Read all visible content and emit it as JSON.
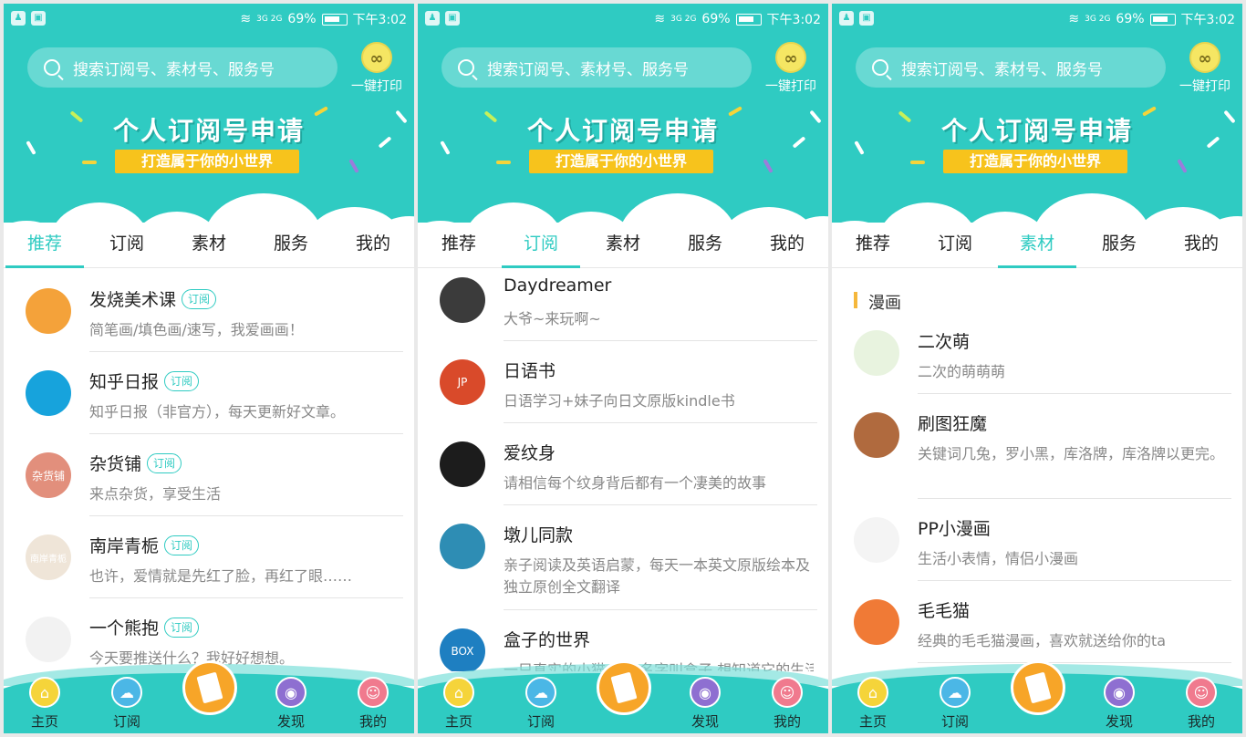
{
  "status_bar": {
    "battery": "69%",
    "time": "下午3:02",
    "network": "3G 2G"
  },
  "header": {
    "search_placeholder": "搜索订阅号、素材号、服务号",
    "print_label": "一键打印",
    "banner_title": "个人订阅号申请",
    "banner_subtitle": "打造属于你的小世界"
  },
  "tabs": [
    "推荐",
    "订阅",
    "素材",
    "服务",
    "我的"
  ],
  "bottom_nav": [
    "主页",
    "订阅",
    "发现",
    "我的"
  ],
  "screens": [
    {
      "active_tab": 0,
      "items": [
        {
          "title": "发烧美术课",
          "badge": "订阅",
          "desc": "简笔画/填色画/速写，我爱画画！",
          "avatar_color": "#f4a23a",
          "avatar_text": ""
        },
        {
          "title": "知乎日报",
          "badge": "订阅",
          "desc": "知乎日报（非官方），每天更新好文章。",
          "avatar_color": "#17a3dc",
          "avatar_text": ""
        },
        {
          "title": "杂货铺",
          "badge": "订阅",
          "desc": "来点杂货，享受生活",
          "avatar_color": "#e28f7c",
          "avatar_text": "杂货铺"
        },
        {
          "title": "南岸青栀",
          "badge": "订阅",
          "desc": "也许，爱情就是先红了脸，再红了眼……",
          "avatar_color": "#efe5d8",
          "avatar_text": "南岸青栀"
        },
        {
          "title": "一个熊抱",
          "badge": "订阅",
          "desc": "今天要推送什么？我好好想想。",
          "avatar_color": "#f2f2f2",
          "avatar_text": ""
        }
      ]
    },
    {
      "active_tab": 1,
      "items": [
        {
          "title": "Daydreamer",
          "desc": "大爷~来玩啊~",
          "avatar_color": "#3b3b3b",
          "avatar_text": ""
        },
        {
          "title": "日语书",
          "desc": "日语学习+妹子向日文原版kindle书",
          "avatar_color": "#d94a2a",
          "avatar_text": "JP"
        },
        {
          "title": "爱纹身",
          "desc": "请相信每个纹身背后都有一个凄美的故事",
          "avatar_color": "#1c1c1c",
          "avatar_text": ""
        },
        {
          "title": "墩儿同款",
          "desc": "亲子阅读及英语启蒙，每天一本英文原版绘本及独立原创全文翻译",
          "avatar_color": "#2e8db4",
          "avatar_text": "",
          "tall": true
        },
        {
          "title": "盒子的世界",
          "desc": "一只真实的小猫 它的名字叫盒子,想知道它的生活就",
          "avatar_color": "#1e7fc1",
          "avatar_text": "BOX"
        }
      ]
    },
    {
      "active_tab": 2,
      "section": "漫画",
      "items": [
        {
          "title": "二次萌",
          "desc": "二次的萌萌萌",
          "avatar_color": "#e8f3df",
          "avatar_text": ""
        },
        {
          "title": "刷图狂魔",
          "desc": "关键词几兔，罗小黑，库洛牌，库洛牌以更完。",
          "avatar_color": "#b06a3e",
          "avatar_text": "",
          "tall": true
        },
        {
          "title": "PP小漫画",
          "desc": "生活小表情，情侣小漫画",
          "avatar_color": "#f4f4f4",
          "avatar_text": ""
        },
        {
          "title": "毛毛猫",
          "desc": "经典的毛毛猫漫画，喜欢就送给你的ta",
          "avatar_color": "#f07a36",
          "avatar_text": ""
        }
      ]
    }
  ],
  "colors": {
    "accent": "#2fcbc2",
    "badge_yellow": "#f7c31c",
    "center_button": "#f7a528"
  }
}
